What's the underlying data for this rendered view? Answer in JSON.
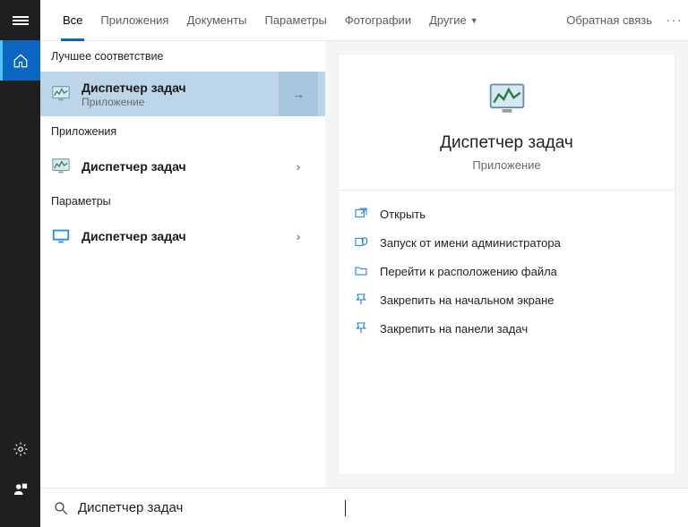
{
  "tabs": {
    "all": "Все",
    "apps": "Приложения",
    "docs": "Документы",
    "settings": "Параметры",
    "photos": "Фотографии",
    "other": "Другие",
    "feedback": "Обратная связь"
  },
  "groups": {
    "best": "Лучшее соответствие",
    "apps": "Приложения",
    "settings": "Параметры"
  },
  "results": {
    "best_title": "Диспетчер задач",
    "best_sub": "Приложение",
    "app_title": "Диспетчер задач",
    "settings_title": "Диспетчер задач"
  },
  "detail": {
    "title": "Диспетчер задач",
    "sub": "Приложение",
    "actions": {
      "open": "Открыть",
      "runadmin": "Запуск от имени администратора",
      "location": "Перейти к расположению файла",
      "pinstart": "Закрепить на начальном экране",
      "pintask": "Закрепить на панели задач"
    }
  },
  "search": {
    "value": "Диспетчер задач"
  }
}
